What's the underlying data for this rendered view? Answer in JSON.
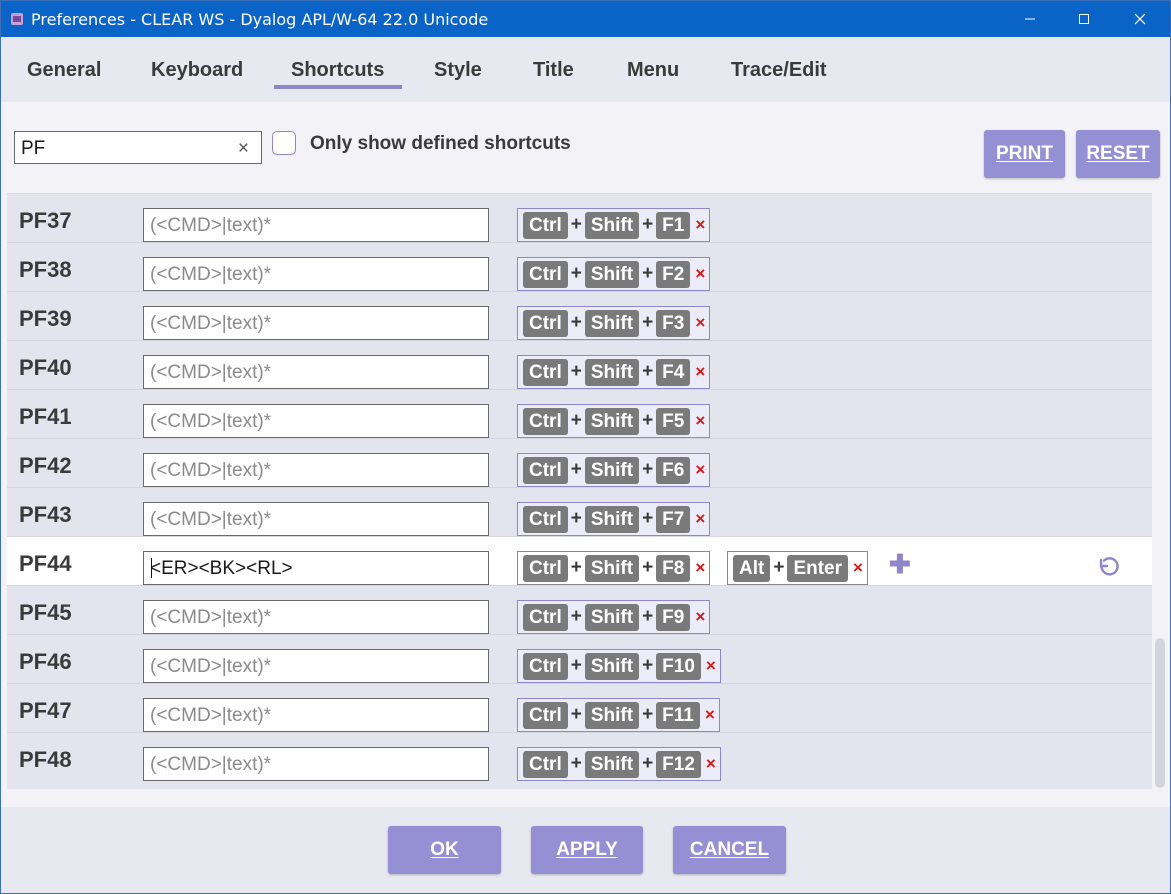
{
  "window": {
    "title": "Preferences - CLEAR WS - Dyalog APL/W-64 22.0 Unicode"
  },
  "tabs": [
    "General",
    "Keyboard",
    "Shortcuts",
    "Style",
    "Title",
    "Menu",
    "Trace/Edit"
  ],
  "active_tab": "Shortcuts",
  "search": {
    "value": "PF",
    "clear": "×"
  },
  "filter": {
    "label": "Only show defined shortcuts",
    "checked": false
  },
  "buttons": {
    "print": "PRINT",
    "reset": "RESET",
    "ok": "OK",
    "apply": "APPLY",
    "cancel": "CANCEL"
  },
  "placeholder": "(<CMD>|text)*",
  "rows": [
    {
      "label": "PF37",
      "value": "",
      "keys": [
        "Ctrl",
        "Shift",
        "F1"
      ]
    },
    {
      "label": "PF38",
      "value": "",
      "keys": [
        "Ctrl",
        "Shift",
        "F2"
      ]
    },
    {
      "label": "PF39",
      "value": "",
      "keys": [
        "Ctrl",
        "Shift",
        "F3"
      ]
    },
    {
      "label": "PF40",
      "value": "",
      "keys": [
        "Ctrl",
        "Shift",
        "F4"
      ]
    },
    {
      "label": "PF41",
      "value": "",
      "keys": [
        "Ctrl",
        "Shift",
        "F5"
      ]
    },
    {
      "label": "PF42",
      "value": "",
      "keys": [
        "Ctrl",
        "Shift",
        "F6"
      ]
    },
    {
      "label": "PF43",
      "value": "",
      "keys": [
        "Ctrl",
        "Shift",
        "F7"
      ]
    },
    {
      "label": "PF44",
      "value": "<ER><BK><RL>",
      "keys": [
        "Ctrl",
        "Shift",
        "F8"
      ],
      "keys2": [
        "Alt",
        "Enter"
      ],
      "selected": true
    },
    {
      "label": "PF45",
      "value": "",
      "keys": [
        "Ctrl",
        "Shift",
        "F9"
      ]
    },
    {
      "label": "PF46",
      "value": "",
      "keys": [
        "Ctrl",
        "Shift",
        "F10"
      ]
    },
    {
      "label": "PF47",
      "value": "",
      "keys": [
        "Ctrl",
        "Shift",
        "F11"
      ]
    },
    {
      "label": "PF48",
      "value": "",
      "keys": [
        "Ctrl",
        "Shift",
        "F12"
      ]
    }
  ],
  "glyphs": {
    "plus": "+",
    "remove": "×",
    "add": "✚"
  },
  "icons": [
    "app-icon",
    "minimize-icon",
    "maximize-icon",
    "close-icon",
    "clear-icon",
    "remove-icon",
    "add-icon",
    "undo-icon"
  ],
  "colors": {
    "titlebar": "#0a64c8",
    "accent": "#9590d4",
    "key": "#7a7a7a",
    "remove": "#d81818"
  }
}
